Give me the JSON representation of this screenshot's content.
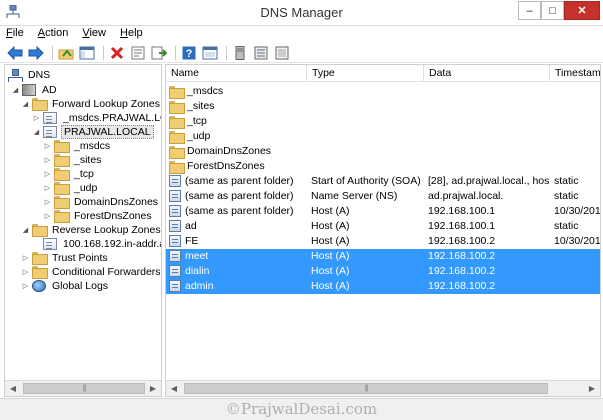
{
  "window": {
    "title": "DNS Manager",
    "minimize": "–",
    "maximize": "□",
    "close": "✕"
  },
  "menu": [
    "File",
    "Action",
    "View",
    "Help"
  ],
  "menu_underline": [
    "F",
    "A",
    "V",
    "H"
  ],
  "toolbar": [
    "back-icon",
    "forward-icon",
    "up-folder-icon",
    "show-hide-console-tree-icon",
    "delete-icon",
    "properties-icon",
    "export-list-icon",
    "help-icon",
    "refresh-icon",
    "server-icon",
    "record-icon",
    "zone-icon"
  ],
  "tree": {
    "root": "DNS",
    "server": "AD",
    "forward": "Forward Lookup Zones",
    "msdcs_zone": "_msdcs.PRAJWAL.LO",
    "prajwal": "PRAJWAL.LOCAL",
    "children": [
      "_msdcs",
      "_sites",
      "_tcp",
      "_udp",
      "DomainDnsZones",
      "ForestDnsZones"
    ],
    "reverse": "Reverse Lookup Zones",
    "reverse_zone": "100.168.192.in-addr.a",
    "trust": "Trust Points",
    "conditional": "Conditional Forwarders",
    "global_logs": "Global Logs"
  },
  "list": {
    "columns": [
      "Name",
      "Type",
      "Data",
      "Timestam"
    ],
    "rows": [
      {
        "name": "_msdcs",
        "type": "",
        "data": "",
        "ts": "",
        "icon": "folder"
      },
      {
        "name": "_sites",
        "type": "",
        "data": "",
        "ts": "",
        "icon": "folder"
      },
      {
        "name": "_tcp",
        "type": "",
        "data": "",
        "ts": "",
        "icon": "folder"
      },
      {
        "name": "_udp",
        "type": "",
        "data": "",
        "ts": "",
        "icon": "folder"
      },
      {
        "name": "DomainDnsZones",
        "type": "",
        "data": "",
        "ts": "",
        "icon": "folder"
      },
      {
        "name": "ForestDnsZones",
        "type": "",
        "data": "",
        "ts": "",
        "icon": "folder"
      },
      {
        "name": "(same as parent folder)",
        "type": "Start of Authority (SOA)",
        "data": "[28], ad.prajwal.local., hos...",
        "ts": "static",
        "icon": "record"
      },
      {
        "name": "(same as parent folder)",
        "type": "Name Server (NS)",
        "data": "ad.prajwal.local.",
        "ts": "static",
        "icon": "record"
      },
      {
        "name": "(same as parent folder)",
        "type": "Host (A)",
        "data": "192.168.100.1",
        "ts": "10/30/201",
        "icon": "record"
      },
      {
        "name": "ad",
        "type": "Host (A)",
        "data": "192.168.100.1",
        "ts": "static",
        "icon": "record"
      },
      {
        "name": "FE",
        "type": "Host (A)",
        "data": "192.168.100.2",
        "ts": "10/30/201",
        "icon": "record"
      },
      {
        "name": "meet",
        "type": "Host (A)",
        "data": "192.168.100.2",
        "ts": "",
        "icon": "record",
        "selected": true
      },
      {
        "name": "dialin",
        "type": "Host (A)",
        "data": "192.168.100.2",
        "ts": "",
        "icon": "record",
        "selected": true
      },
      {
        "name": "admin",
        "type": "Host (A)",
        "data": "192.168.100.2",
        "ts": "",
        "icon": "record",
        "selected": true
      }
    ]
  },
  "watermark": "©PrajwalDesai.com"
}
